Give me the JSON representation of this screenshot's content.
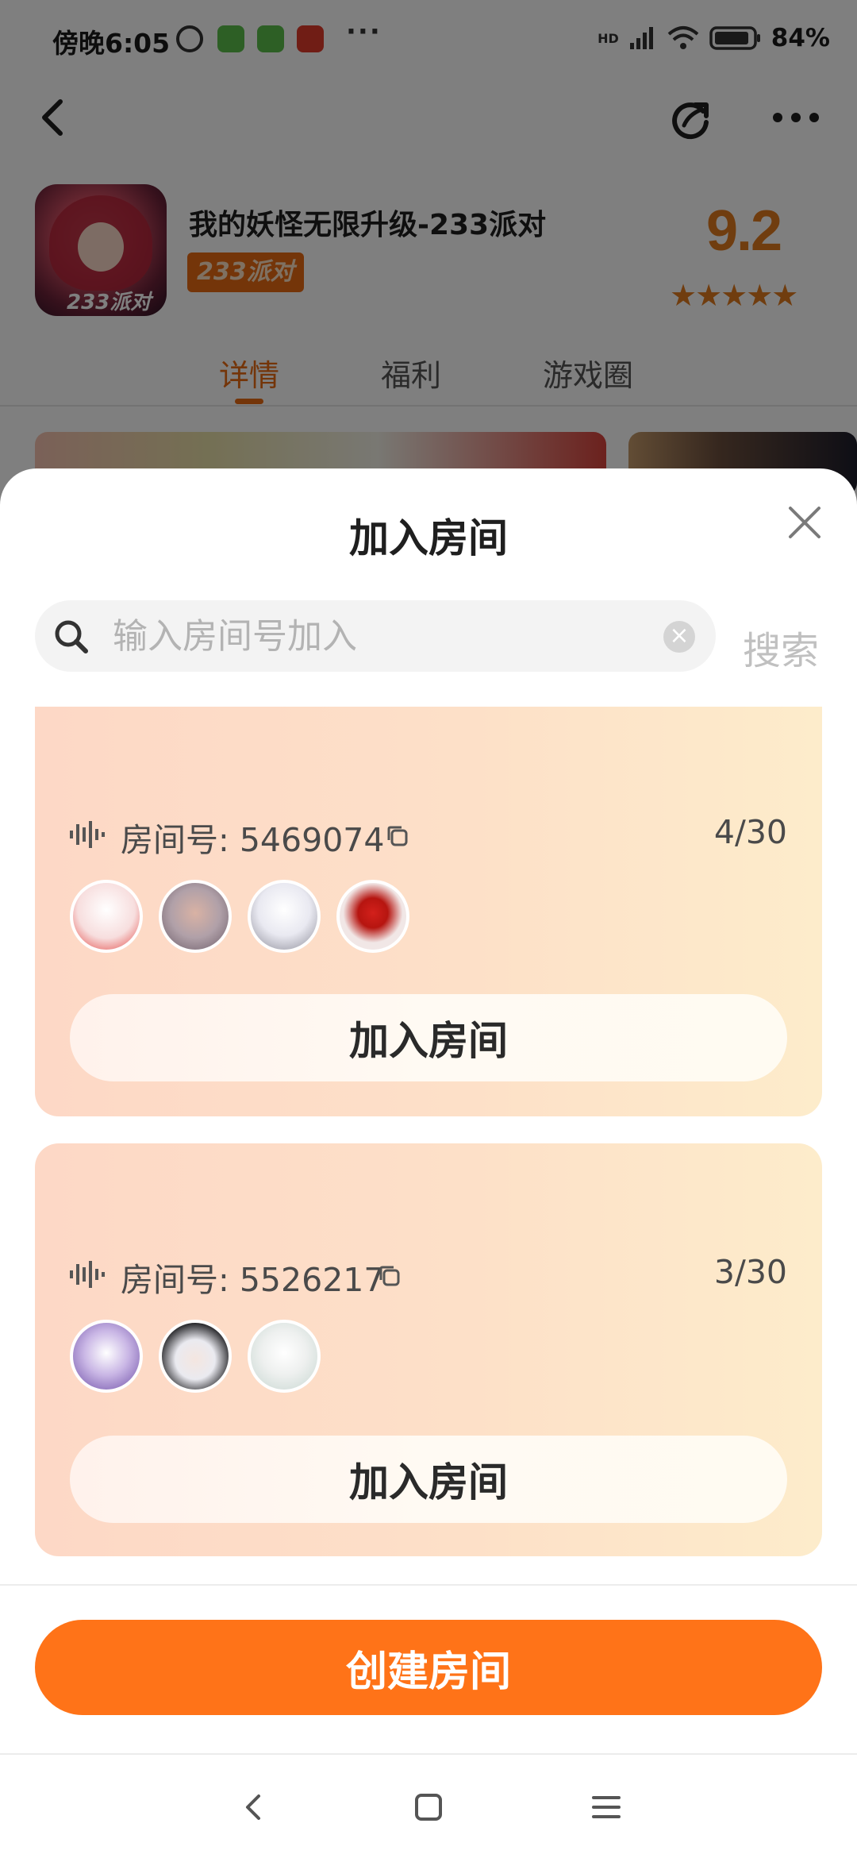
{
  "status_bar": {
    "time": "傍晚6:05",
    "more_dots": "···",
    "network": "HD",
    "battery": "84%"
  },
  "header": {
    "back_icon": "chevron-left-icon",
    "share_icon": "share-icon",
    "more_icon": "more-dots-icon"
  },
  "app": {
    "title": "我的妖怪无限升级-233派对",
    "badge": "233派对",
    "icon_tag": "233派对",
    "rating": "9.2",
    "stars": "★★★★★",
    "stars_value": 4.6
  },
  "tabs": [
    {
      "label": "详情",
      "active": true
    },
    {
      "label": "福利",
      "active": false
    },
    {
      "label": "游戏圈",
      "active": false
    }
  ],
  "sheet": {
    "title": "加入房间",
    "close_icon": "close-icon",
    "search": {
      "placeholder": "输入房间号加入",
      "value": "",
      "button_label": "搜索"
    },
    "rooms": [
      {
        "label": "房间号: 5469074",
        "count": "4/30",
        "join_label": "加入房间",
        "avatars": [
          {
            "name": "avatar-red-white-outfit",
            "bg": "#f7dede",
            "accent": "#e2433f"
          },
          {
            "name": "avatar-brown-hair-girl",
            "bg": "#b0a0a8",
            "accent": "#d9b2a4"
          },
          {
            "name": "avatar-white-hair-chibi",
            "bg": "#e9e9f1",
            "accent": "#ffffff"
          },
          {
            "name": "avatar-red-costume",
            "bg": "#f1e7e6",
            "accent": "#d3201b"
          }
        ]
      },
      {
        "label": "房间号: 5526217",
        "count": "3/30",
        "join_label": "加入房间",
        "avatars": [
          {
            "name": "avatar-purple-outfit",
            "bg": "#c9b6e5",
            "accent": "#6d4ea6"
          },
          {
            "name": "avatar-black-hair-boy",
            "bg": "#eaeaf0",
            "accent": "#1f1f22"
          },
          {
            "name": "avatar-white-fluffy",
            "bg": "#eef0ef",
            "accent": "#c6d6d0"
          }
        ]
      }
    ],
    "create_label": "创建房间"
  },
  "colors": {
    "accent": "#ff7318",
    "orange_text": "#e86a12",
    "card_start": "#fdd8c6",
    "card_end": "#fdeccb"
  }
}
